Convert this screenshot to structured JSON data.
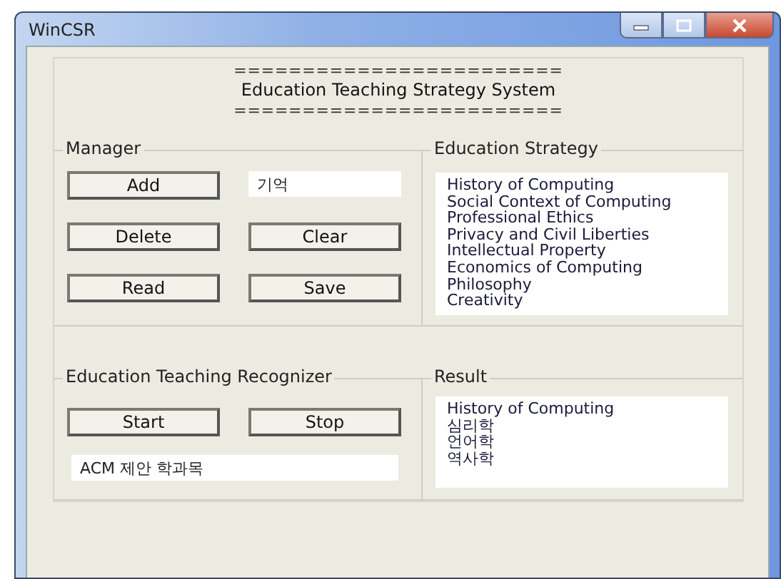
{
  "window": {
    "title": "WinCSR"
  },
  "header": {
    "rule_top": "========================",
    "title": "Education Teaching Strategy System",
    "rule_bottom": "========================"
  },
  "manager": {
    "title": "Manager",
    "buttons": [
      {
        "label": "Add"
      },
      {
        "label": "Delete"
      },
      {
        "label": "Clear"
      },
      {
        "label": "Read"
      },
      {
        "label": "Save"
      }
    ],
    "input": {
      "value": "기억"
    }
  },
  "strategy": {
    "title": "Education Strategy",
    "items": [
      "History of Computing",
      "Social Context of Computing",
      "Professional Ethics",
      "Privacy and  Civil Liberties",
      "Intellectual Property",
      "Economics of Computing",
      "Philosophy",
      "Creativity"
    ]
  },
  "recognizer": {
    "title": "Education Teaching Recognizer",
    "buttons": [
      {
        "label": "Start"
      },
      {
        "label": "Stop"
      }
    ],
    "input": {
      "value": "ACM 제안 학과목"
    }
  },
  "result": {
    "title": "Result",
    "items": [
      "History of Computing",
      "심리학",
      "언어학",
      "역사학"
    ]
  }
}
